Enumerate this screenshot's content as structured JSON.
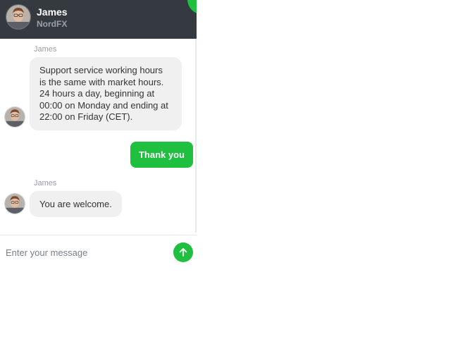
{
  "header": {
    "agent_name": "James",
    "company": "NordFX"
  },
  "messages": [
    {
      "direction": "incoming",
      "sender": "James",
      "lines": [
        "Support service working hours",
        "is the same with market hours.",
        "24 hours a day, beginning at",
        "00:00 on Monday and ending at",
        "22:00 on Friday (CET)."
      ]
    },
    {
      "direction": "outgoing",
      "text": "Thank you"
    },
    {
      "direction": "incoming",
      "sender": "James",
      "text": "You are welcome."
    }
  ],
  "composer": {
    "placeholder": "Enter your message"
  },
  "icons": {
    "send": "arrow-up-icon",
    "avatar": "person-avatar-icon"
  },
  "colors": {
    "header_bg": "#353a40",
    "accent": "#1fbf3f",
    "bubble_in": "#f0f0f0"
  }
}
